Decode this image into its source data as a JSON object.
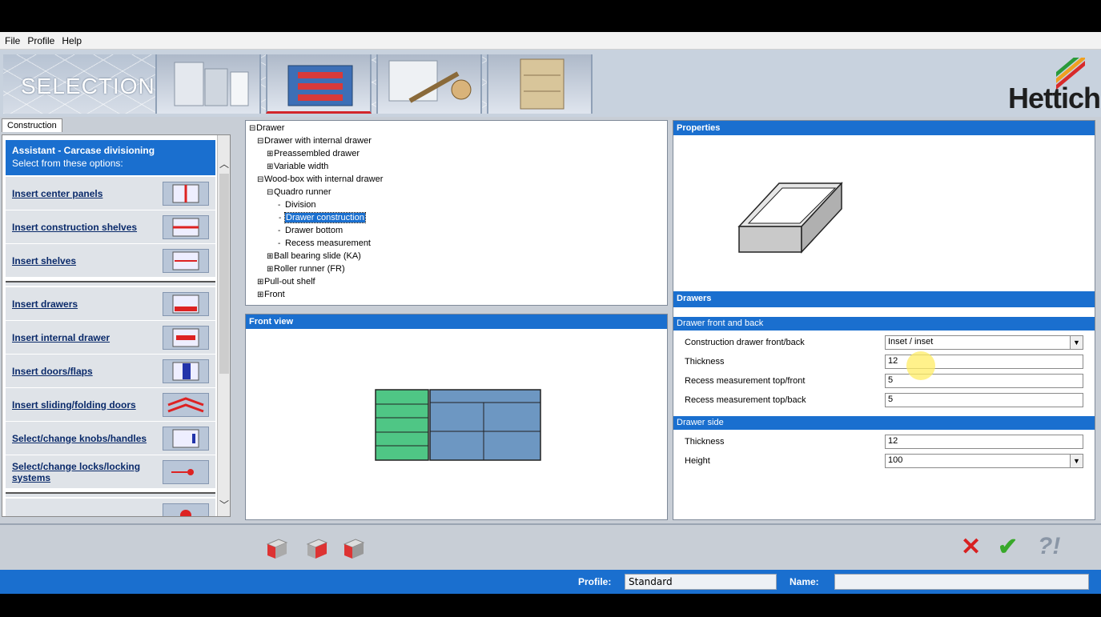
{
  "menu": [
    "File",
    "Profile",
    "Help"
  ],
  "banner": {
    "title": "SELECTION",
    "logo_text": "Hettich"
  },
  "left": {
    "tab": "Construction",
    "assistant_title": "Assistant - Carcase divisioning",
    "assistant_subtitle": "Select from these options:",
    "options": [
      "Insert center panels",
      "Insert construction shelves",
      "Insert shelves",
      "Insert drawers",
      "Insert internal drawer",
      "Insert doors/flaps",
      "Insert sliding/folding doors",
      "Select/change knobs/handles",
      "Select/change locks/locking systems"
    ]
  },
  "tree": {
    "items": [
      {
        "label": "Drawer",
        "pm": "⊟"
      },
      {
        "label": "Drawer with internal drawer",
        "pm": "⊟"
      },
      {
        "label": "Preassembled drawer",
        "pm": "⊞"
      },
      {
        "label": "Variable width",
        "pm": "⊞"
      },
      {
        "label": "Wood-box with internal drawer",
        "pm": "⊟"
      },
      {
        "label": "Quadro runner",
        "pm": "⊟"
      },
      {
        "label": "Division",
        "pm": "-"
      },
      {
        "label": "Drawer construction",
        "pm": "-"
      },
      {
        "label": "Drawer bottom",
        "pm": "-"
      },
      {
        "label": "Recess measurement",
        "pm": "-"
      },
      {
        "label": "Ball bearing slide (KA)",
        "pm": "⊞"
      },
      {
        "label": "Roller runner (FR)",
        "pm": "⊞"
      },
      {
        "label": "Pull-out shelf",
        "pm": "⊞"
      },
      {
        "label": "Front",
        "pm": "⊞"
      }
    ]
  },
  "frontview": {
    "title": "Front view"
  },
  "properties": {
    "title": "Properties",
    "drawers_title": "Drawers",
    "front_back_title": "Drawer front and back",
    "front_back_rows": [
      {
        "label": "Construction drawer front/back",
        "value": "Inset / inset",
        "dropdown": true
      },
      {
        "label": "Thickness",
        "value": "12",
        "dropdown": false
      },
      {
        "label": "Recess measurement top/front",
        "value": "5",
        "dropdown": false
      },
      {
        "label": "Recess measurement top/back",
        "value": "5",
        "dropdown": false
      }
    ],
    "side_title": "Drawer side",
    "side_rows": [
      {
        "label": "Thickness",
        "value": "12",
        "dropdown": false
      },
      {
        "label": "Height",
        "value": "100",
        "dropdown": true
      }
    ]
  },
  "status": {
    "profile_label": "Profile:",
    "profile_value": "Standard",
    "name_label": "Name:",
    "name_value": ""
  },
  "colors": {
    "accent": "#1a6fcf",
    "panel": "#c8ced6",
    "drawer_green": "#4fc685",
    "drawer_blue": "#6d97c2"
  }
}
